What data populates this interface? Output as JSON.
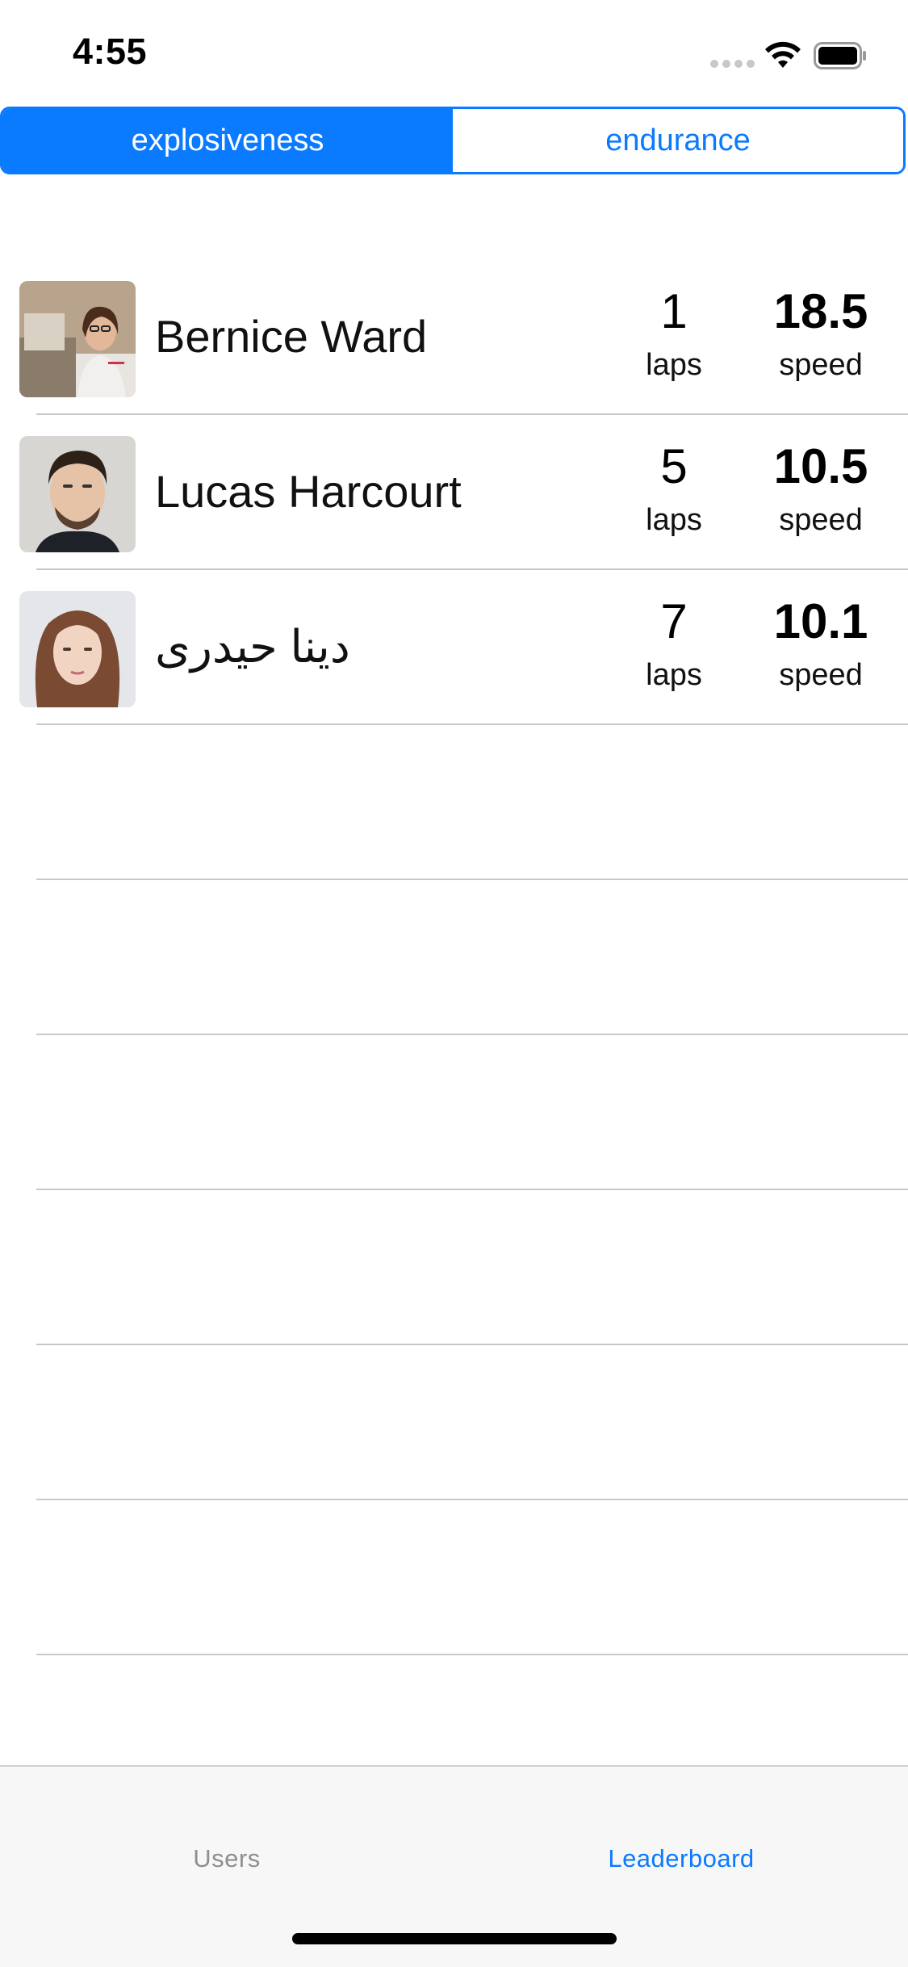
{
  "status_bar": {
    "time": "4:55",
    "icons": [
      "signal-dots-icon",
      "wifi-icon",
      "battery-icon"
    ]
  },
  "segmented_control": {
    "segments": [
      {
        "label": "explosiveness",
        "selected": true
      },
      {
        "label": "endurance",
        "selected": false
      }
    ],
    "accent_color": "#0a7aff"
  },
  "leaderboard": {
    "rows": [
      {
        "name": "Bernice Ward",
        "laps_value": "1",
        "laps_label": "laps",
        "speed_value": "18.5",
        "speed_label": "speed"
      },
      {
        "name": "Lucas Harcourt",
        "laps_value": "5",
        "laps_label": "laps",
        "speed_value": "10.5",
        "speed_label": "speed"
      },
      {
        "name": "دينا حيدری",
        "laps_value": "7",
        "laps_label": "laps",
        "speed_value": "10.1",
        "speed_label": "speed"
      }
    ]
  },
  "tab_bar": {
    "tabs": [
      {
        "label": "Users",
        "selected": false
      },
      {
        "label": "Leaderboard",
        "selected": true
      }
    ],
    "selected_color": "#0a7aff",
    "unselected_color": "#8e8e93"
  }
}
